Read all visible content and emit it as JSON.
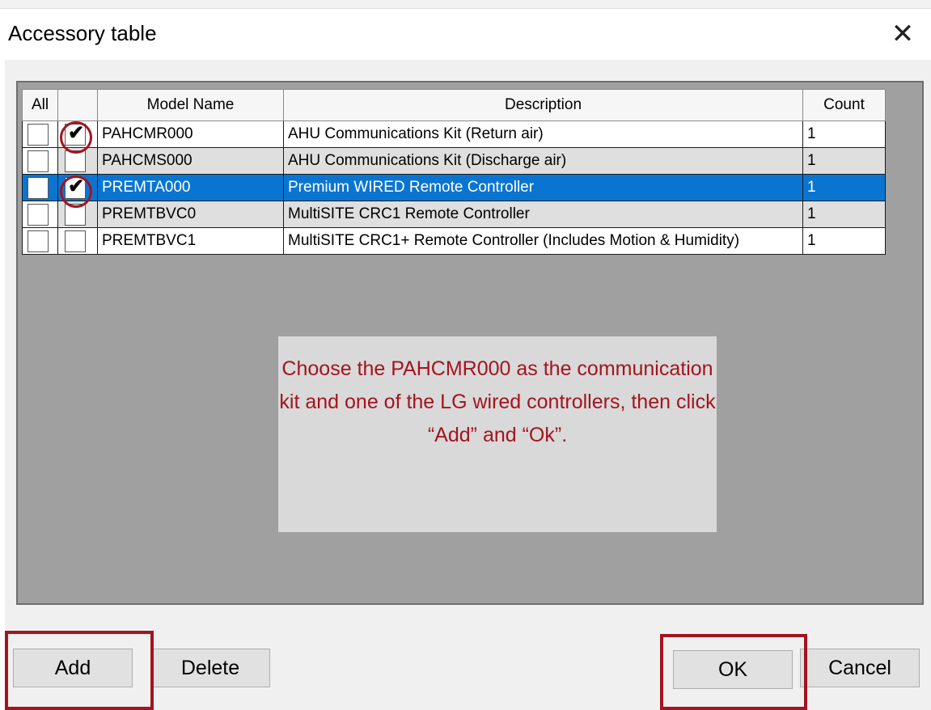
{
  "dialog": {
    "title": "Accessory table"
  },
  "table": {
    "headers": {
      "all": "All",
      "model": "Model Name",
      "description": "Description",
      "count": "Count"
    },
    "rows": [
      {
        "model": "PAHCMR000",
        "description": "AHU Communications Kit (Return air)",
        "count": "1",
        "checked": true,
        "selected": false
      },
      {
        "model": "PAHCMS000",
        "description": "AHU Communications Kit (Discharge air)",
        "count": "1",
        "checked": false,
        "selected": false
      },
      {
        "model": "PREMTA000",
        "description": "Premium WIRED Remote Controller",
        "count": "1",
        "checked": true,
        "selected": true
      },
      {
        "model": "PREMTBVC0",
        "description": "MultiSITE CRC1 Remote Controller",
        "count": "1",
        "checked": false,
        "selected": false
      },
      {
        "model": "PREMTBVC1",
        "description": "MultiSITE CRC1+ Remote Controller (Includes Motion & Humidity)",
        "count": "1",
        "checked": false,
        "selected": false
      }
    ]
  },
  "annotation": {
    "text": "Choose the PAHCMR000 as the communication kit and one of the LG wired controllers, then click “Add” and “Ok”."
  },
  "buttons": {
    "add": "Add",
    "delete": "Delete",
    "ok": "OK",
    "cancel": "Cancel"
  },
  "colors": {
    "highlight": "#a3141f",
    "selection": "#0a75d1"
  }
}
